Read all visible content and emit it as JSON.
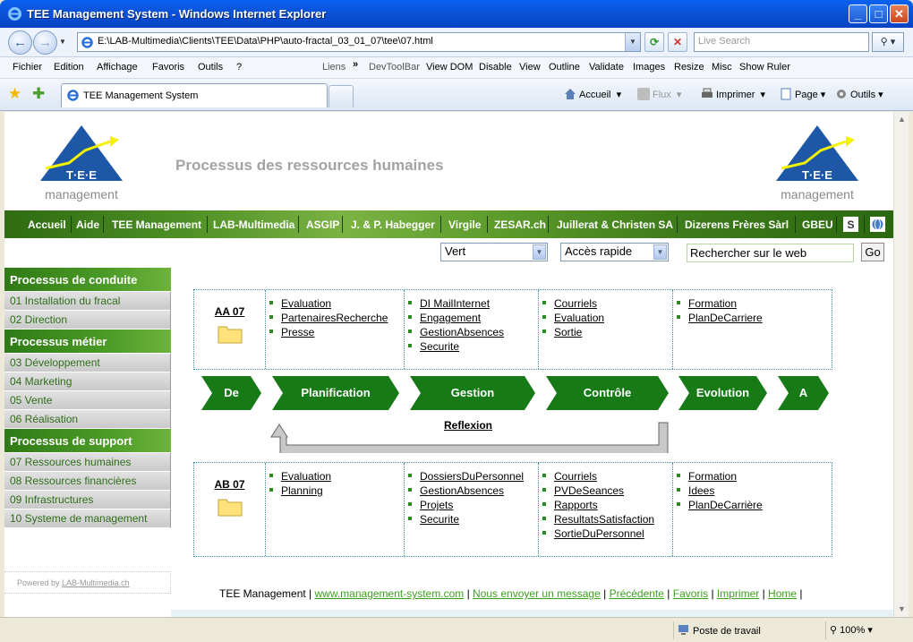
{
  "window": {
    "title": "TEE Management System - Windows Internet Explorer"
  },
  "address": {
    "url": "E:\\LAB-Multimedia\\Clients\\TEE\\Data\\PHP\\auto-fractal_03_01_07\\tee\\07.html",
    "search_placeholder": "Live Search"
  },
  "menubar": {
    "items": [
      "Fichier",
      "Edition",
      "Affichage",
      "Favoris",
      "Outils",
      "?"
    ],
    "links_label": "Liens",
    "links": [
      "DevToolBar",
      "View DOM",
      "Disable",
      "View",
      "Outline",
      "Validate",
      "Images",
      "Resize",
      "Misc",
      "Show Ruler"
    ]
  },
  "tab": {
    "title": "TEE Management System"
  },
  "commandbar": {
    "home": "Accueil",
    "feeds": "Flux",
    "print": "Imprimer",
    "page": "Page",
    "tools": "Outils"
  },
  "page": {
    "heading": "Processus des ressources humaines",
    "logo_text": "management",
    "logo_letters": "T·E·E",
    "topnav": [
      "Accueil",
      "Aide",
      "TEE Management",
      "LAB-Multimedia",
      "ASGIP",
      "J. & P. Habegger",
      "Virgile",
      "ZESAR.ch",
      "Juillerat & Christen SA",
      "Dizerens Frères Sàrl",
      "GBEU"
    ],
    "color_select": "Vert",
    "quick_access": "Accès rapide",
    "search_value": "Rechercher sur le web",
    "go_label": "Go",
    "sidebar": [
      {
        "heading": "Processus de conduite",
        "items": [
          "01 Installation du fracal",
          "02 Direction"
        ]
      },
      {
        "heading": "Processus métier",
        "items": [
          "03 Développement",
          "04 Marketing",
          "05 Vente",
          "06 Réalisation"
        ]
      },
      {
        "heading": "Processus de support",
        "items": [
          "07 Ressources humaines",
          "08 Ressources financières",
          "09 Infrastructures",
          "10 Systeme de management"
        ]
      }
    ],
    "powered_by": "Powered by",
    "powered_link": "LAB-Multimedia.ch",
    "process_top": {
      "code": "AA 07",
      "columns": [
        [
          "Evaluation",
          "PartenairesRecherche",
          "Presse"
        ],
        [
          "DI MailInternet",
          "Engagement",
          "GestionAbsences",
          "Securite"
        ],
        [
          "Courriels",
          "Evaluation",
          "Sortie"
        ],
        [
          "Formation",
          "PlanDeCarriere"
        ]
      ]
    },
    "process_bottom": {
      "code": "AB 07",
      "columns": [
        [
          "Evaluation",
          "Planning"
        ],
        [
          "DossiersDuPersonnel",
          "GestionAbsences",
          "Projets",
          "Securite"
        ],
        [
          "Courriels",
          "PVDeSeances",
          "Rapports",
          "ResultatsSatisfaction",
          "SortieDuPersonnel"
        ],
        [
          "Formation",
          "Idees",
          "PlanDeCarrière"
        ]
      ]
    },
    "stages": [
      "De",
      "Planification",
      "Gestion",
      "Contrôle",
      "Evolution",
      "A"
    ],
    "feedback_label": "Reflexion",
    "footer": {
      "company": "TEE Management",
      "links": [
        "www.management-system.com",
        "Nous envoyer un message",
        "Précédente",
        "Favoris",
        "Imprimer",
        "Home"
      ]
    }
  },
  "status": {
    "zone": "Poste de travail",
    "zoom": "100%"
  },
  "colors": {
    "green_dark": "#1E7A0F",
    "green_link": "#3DA11E",
    "heading_gray": "#A3A3A3",
    "logo_blue": "#1D57A6",
    "logo_yellow": "#F4F200"
  }
}
